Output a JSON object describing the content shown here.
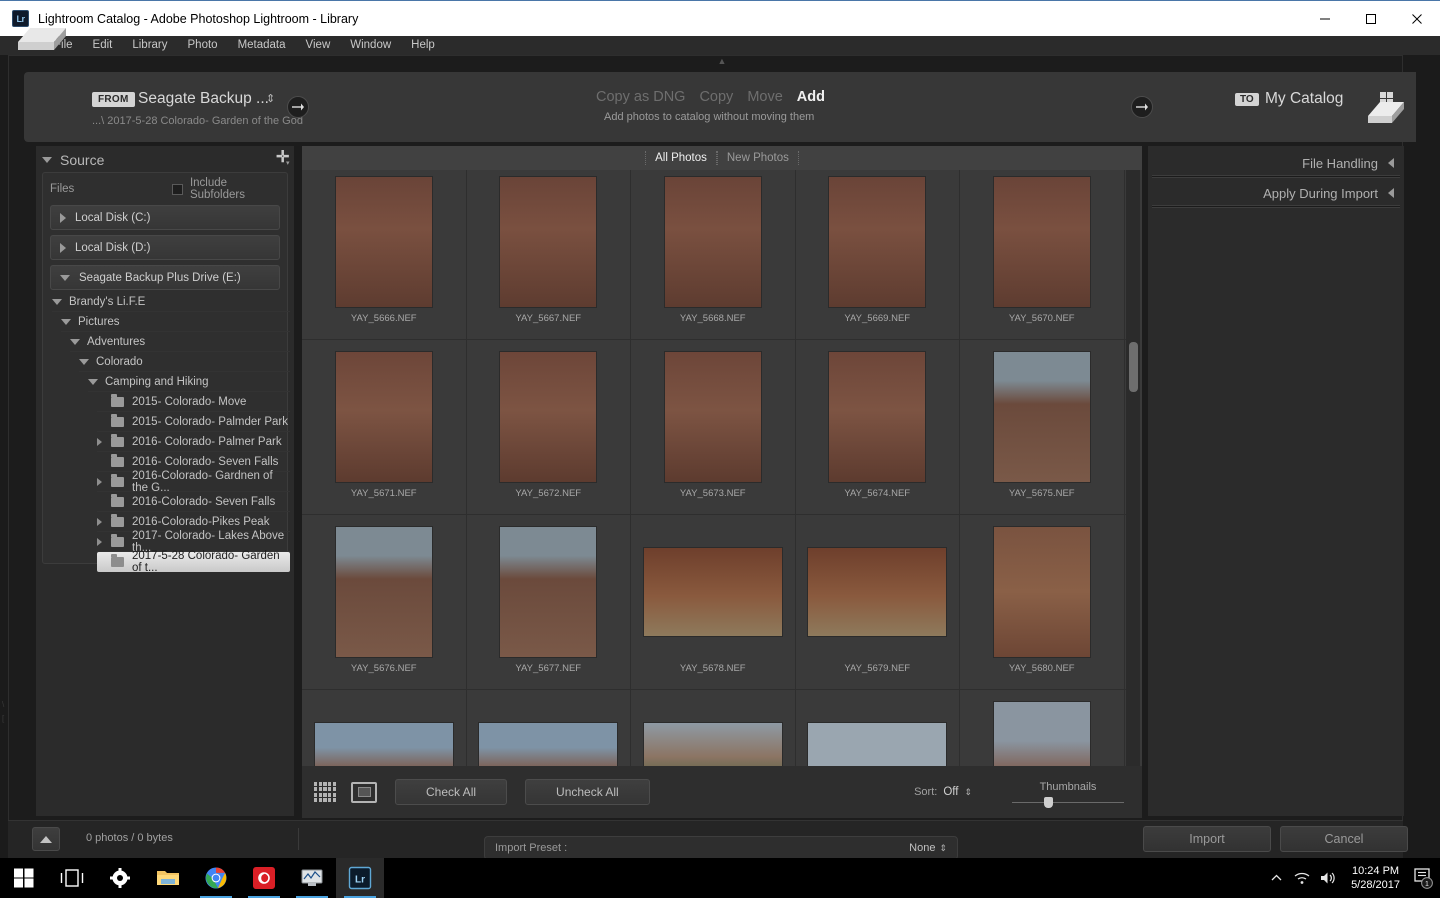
{
  "window": {
    "title": "Lightroom Catalog - Adobe Photoshop Lightroom - Library",
    "app_badge": "Lr",
    "minimize": "minimize-button",
    "maximize": "maximize-button",
    "close": "close-button"
  },
  "menubar": [
    "File",
    "Edit",
    "Library",
    "Photo",
    "Metadata",
    "View",
    "Window",
    "Help"
  ],
  "import_header": {
    "from_label": "FROM",
    "from_source": "Seagate Backup ...",
    "from_path": "...\\ 2017-5-28 Colorado- Garden of the God",
    "modes": [
      {
        "label": "Copy as DNG",
        "active": false
      },
      {
        "label": "Copy",
        "active": false
      },
      {
        "label": "Move",
        "active": false
      },
      {
        "label": "Add",
        "active": true
      }
    ],
    "mode_description": "Add photos to catalog without moving them",
    "to_label": "TO",
    "to_catalog": "My Catalog"
  },
  "source_panel": {
    "title": "Source",
    "files_label": "Files",
    "include_subfolders_label": "Include Subfolders",
    "include_subfolders_checked": false,
    "drives": [
      {
        "name": "Local Disk (C:)",
        "expanded": false
      },
      {
        "name": "Local Disk (D:)",
        "expanded": false
      },
      {
        "name": "Seagate Backup Plus Drive (E:)",
        "expanded": true
      }
    ],
    "tree": [
      {
        "label": "Brandy's Li.F.E",
        "depth": 1,
        "type": "node",
        "expanded": true
      },
      {
        "label": "Pictures",
        "depth": 2,
        "type": "node",
        "expanded": true
      },
      {
        "label": "Adventures",
        "depth": 3,
        "type": "node",
        "expanded": true
      },
      {
        "label": "Colorado",
        "depth": 4,
        "type": "node",
        "expanded": true
      },
      {
        "label": "Camping and Hiking",
        "depth": 5,
        "type": "node",
        "expanded": true
      },
      {
        "label": "2015- Colorado- Move",
        "depth": 6,
        "type": "folder",
        "expandable": false,
        "selected": false
      },
      {
        "label": "2015- Colorado- Palmder Park",
        "depth": 6,
        "type": "folder",
        "expandable": false,
        "selected": false
      },
      {
        "label": "2016- Colorado- Palmer Park",
        "depth": 6,
        "type": "folder",
        "expandable": true,
        "selected": false
      },
      {
        "label": "2016- Colorado- Seven Falls",
        "depth": 6,
        "type": "folder",
        "expandable": false,
        "selected": false
      },
      {
        "label": "2016-Colorado- Gardnen of the G...",
        "depth": 6,
        "type": "folder",
        "expandable": true,
        "selected": false
      },
      {
        "label": "2016-Colorado- Seven Falls",
        "depth": 6,
        "type": "folder",
        "expandable": false,
        "selected": false
      },
      {
        "label": "2016-Colorado-Pikes Peak",
        "depth": 6,
        "type": "folder",
        "expandable": true,
        "selected": false
      },
      {
        "label": "2017- Colorado- Lakes Above th...",
        "depth": 6,
        "type": "folder",
        "expandable": true,
        "selected": false
      },
      {
        "label": "2017-5-28 Colorado- Garden of t...",
        "depth": 6,
        "type": "folder",
        "expandable": false,
        "selected": true
      }
    ]
  },
  "grid": {
    "tabs": [
      {
        "label": "All Photos",
        "active": true
      },
      {
        "label": "New Photos",
        "active": false
      }
    ],
    "rows": [
      {
        "cells": [
          {
            "filename": "YAY_5666.NEF",
            "orientation": "portrait",
            "scene": "rock-crevice-person"
          },
          {
            "filename": "YAY_5667.NEF",
            "orientation": "portrait",
            "scene": "rock-crevice-person"
          },
          {
            "filename": "YAY_5668.NEF",
            "orientation": "portrait",
            "scene": "rock-crevice-person"
          },
          {
            "filename": "YAY_5669.NEF",
            "orientation": "portrait",
            "scene": "rock-crevice-person"
          },
          {
            "filename": "YAY_5670.NEF",
            "orientation": "portrait",
            "scene": "rock-crevice-person"
          }
        ]
      },
      {
        "cells": [
          {
            "filename": "YAY_5671.NEF",
            "orientation": "portrait",
            "scene": "rock-crevice-couple"
          },
          {
            "filename": "YAY_5672.NEF",
            "orientation": "portrait",
            "scene": "rock-crevice-couple"
          },
          {
            "filename": "YAY_5673.NEF",
            "orientation": "portrait",
            "scene": "rock-crevice-couple"
          },
          {
            "filename": "YAY_5674.NEF",
            "orientation": "portrait",
            "scene": "rock-crevice-couple"
          },
          {
            "filename": "YAY_5675.NEF",
            "orientation": "portrait",
            "scene": "rock-spire"
          }
        ]
      },
      {
        "cells": [
          {
            "filename": "YAY_5676.NEF",
            "orientation": "portrait",
            "scene": "rock-spire"
          },
          {
            "filename": "YAY_5677.NEF",
            "orientation": "portrait",
            "scene": "rock-spire"
          },
          {
            "filename": "YAY_5678.NEF",
            "orientation": "landscape",
            "scene": "cave-ledge-woman"
          },
          {
            "filename": "YAY_5679.NEF",
            "orientation": "landscape",
            "scene": "cave-ledge-woman"
          },
          {
            "filename": "YAY_5680.NEF",
            "orientation": "portrait",
            "scene": "climber-on-rock"
          }
        ]
      },
      {
        "cells": [
          {
            "filename": "",
            "orientation": "landscape",
            "scene": "rock-formation-sky"
          },
          {
            "filename": "",
            "orientation": "landscape",
            "scene": "rock-formation-sky"
          },
          {
            "filename": "",
            "orientation": "landscape",
            "scene": "peak-with-trees"
          },
          {
            "filename": "",
            "orientation": "landscape",
            "scene": "pale-sky-rock"
          },
          {
            "filename": "",
            "orientation": "portrait",
            "scene": "hikers-on-ridge"
          }
        ]
      }
    ]
  },
  "grid_toolbar": {
    "grid_view_icon": "grid-view-icon",
    "loupe_view_icon": "loupe-view-icon",
    "check_all": "Check All",
    "uncheck_all": "Uncheck All",
    "sort_label": "Sort:",
    "sort_value": "Off",
    "thumbnails_label": "Thumbnails"
  },
  "right_panel": {
    "sections": [
      {
        "title": "File Handling"
      },
      {
        "title": "Apply During Import"
      }
    ]
  },
  "bottom_bar": {
    "photo_count": "0 photos / 0 bytes",
    "import_preset_label": "Import Preset :",
    "import_preset_value": "None",
    "import_button": "Import",
    "cancel_button": "Cancel"
  },
  "taskbar": {
    "items": [
      {
        "name": "start-button",
        "icon": "windows-logo"
      },
      {
        "name": "task-view-button",
        "icon": "task-view"
      },
      {
        "name": "settings-button",
        "icon": "gear"
      },
      {
        "name": "file-explorer-button",
        "icon": "folder"
      },
      {
        "name": "chrome-button",
        "icon": "chrome"
      },
      {
        "name": "creative-cloud-button",
        "icon": "creative-cloud"
      },
      {
        "name": "monitor-app-button",
        "icon": "monitor"
      },
      {
        "name": "lightroom-button",
        "icon": "lightroom"
      }
    ],
    "tray": {
      "show_hidden": "chevron-up-icon",
      "network": "wifi-icon",
      "volume": "speaker-icon",
      "time": "10:24 PM",
      "date": "5/28/2017",
      "notification_count": "1"
    }
  },
  "colors": {
    "panel_bg": "#2b2b2b",
    "grid_bg": "#3a3a3a",
    "accent": "#4aa3e0",
    "text": "#c8c8c8"
  }
}
